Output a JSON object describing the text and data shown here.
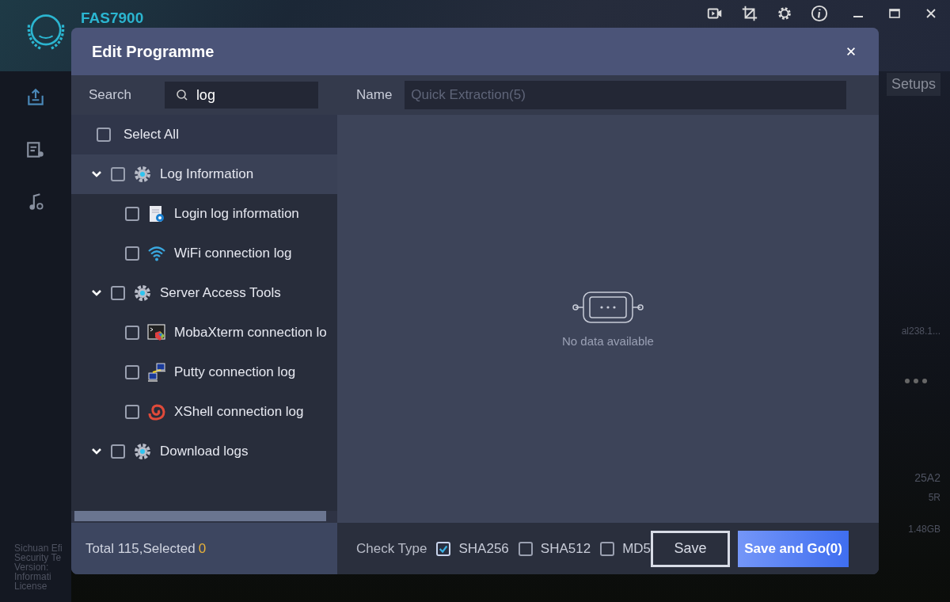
{
  "app": {
    "title": "FAS7900",
    "setups_button": "Setups",
    "side_texts": [
      "al238.1...",
      "25A2",
      "5R",
      "1.48GB"
    ],
    "footer_texts": [
      "Sichuan Efi",
      "Security Te",
      "Version:",
      "Informati",
      "License"
    ]
  },
  "dialog": {
    "title": "Edit Programme",
    "search": {
      "label": "Search",
      "value": "log"
    },
    "select_all": {
      "label": "Select All",
      "checked": false
    },
    "tree": [
      {
        "label": "Log Information",
        "expanded": true,
        "checked": false,
        "selected": true,
        "children": [
          {
            "label": "Login log information",
            "checked": false,
            "kind": "document"
          },
          {
            "label": "WiFi connection log",
            "checked": false,
            "kind": "wifi"
          }
        ]
      },
      {
        "label": "Server Access Tools",
        "expanded": true,
        "checked": false,
        "selected": false,
        "children": [
          {
            "label": "MobaXterm connection lo",
            "checked": false,
            "kind": "terminal"
          },
          {
            "label": "Putty connection log",
            "checked": false,
            "kind": "computers"
          },
          {
            "label": "XShell connection log",
            "checked": false,
            "kind": "shell"
          }
        ]
      },
      {
        "label": "Download logs",
        "expanded": true,
        "checked": false,
        "selected": false
      }
    ],
    "total_label": "Total 115,Selected",
    "selected_count": "0",
    "name": {
      "label": "Name",
      "placeholder": "Quick Extraction(5)"
    },
    "empty_text": "No data available",
    "check_type": {
      "label": "Check Type",
      "options": [
        {
          "label": "SHA256",
          "checked": true
        },
        {
          "label": "SHA512",
          "checked": false
        },
        {
          "label": "MD5",
          "checked": false
        }
      ]
    },
    "buttons": [
      {
        "label": "Save",
        "kind": "outline"
      },
      {
        "label": "Save and Go(0)",
        "kind": "primary"
      }
    ]
  }
}
